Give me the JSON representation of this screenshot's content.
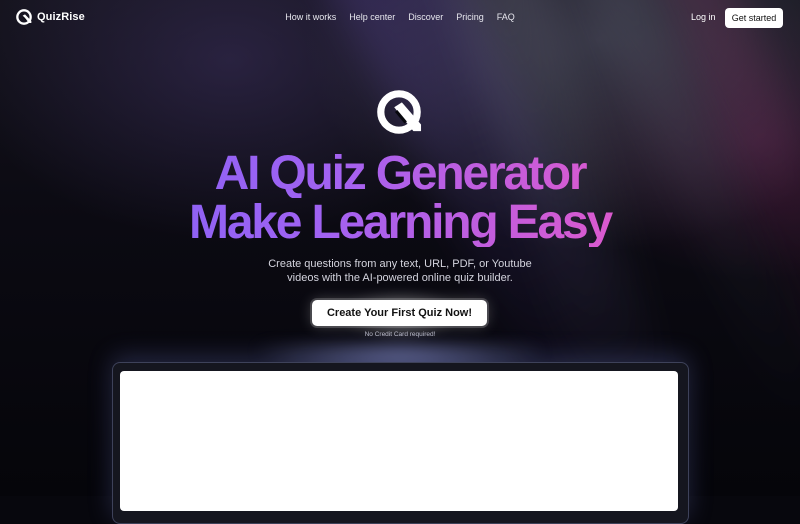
{
  "nav": {
    "brand": "QuizRise",
    "links": [
      "How it works",
      "Help center",
      "Discover",
      "Pricing",
      "FAQ"
    ],
    "login": "Log in",
    "get_started": "Get started"
  },
  "hero": {
    "line1": "AI Quiz Generator",
    "line2": "Make Learning Easy",
    "subtitle_line1": "Create questions from any text, URL, PDF, or Youtube",
    "subtitle_line2": "videos with the AI-powered online quiz builder.",
    "cta": "Create Your First Quiz Now!",
    "note": "No Credit Card required!"
  },
  "icons": {
    "brand_logo": "quizrise-logo-icon",
    "hero_logo": "quizrise-logo-icon"
  },
  "colors": {
    "background": "#07070d",
    "headline_gradient_start": "#7a62f7",
    "headline_gradient_end": "#ea4fb1",
    "button_bg": "#ffffff",
    "button_text": "#111111"
  }
}
